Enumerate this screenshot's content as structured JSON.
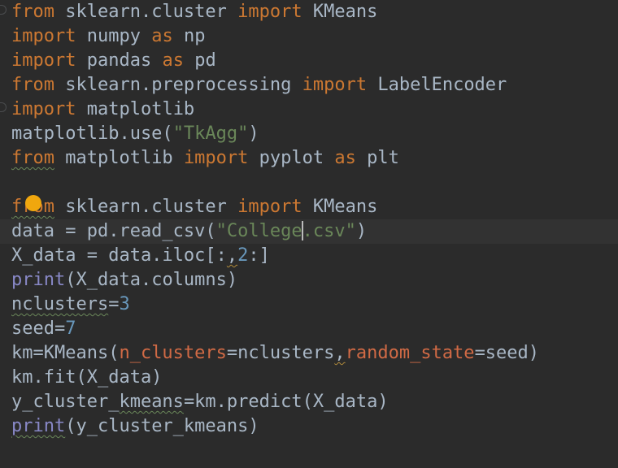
{
  "editor": {
    "lines": [
      {
        "t": [
          [
            "kw",
            "from"
          ],
          [
            "id",
            " sklearn.cluster "
          ],
          [
            "kw",
            "import"
          ],
          [
            "id",
            " KMeans"
          ]
        ]
      },
      {
        "t": [
          [
            "kw",
            "import"
          ],
          [
            "id",
            " numpy "
          ],
          [
            "kw",
            "as"
          ],
          [
            "id",
            " np"
          ]
        ]
      },
      {
        "t": [
          [
            "kw",
            "import"
          ],
          [
            "id",
            " pandas "
          ],
          [
            "kw",
            "as"
          ],
          [
            "id",
            " pd"
          ]
        ]
      },
      {
        "t": [
          [
            "kw",
            "from"
          ],
          [
            "id",
            " sklearn.preprocessing "
          ],
          [
            "kw",
            "import"
          ],
          [
            "id",
            " LabelEncoder"
          ]
        ]
      },
      {
        "t": [
          [
            "kw",
            "import"
          ],
          [
            "id",
            " matplotlib"
          ]
        ]
      },
      {
        "t": [
          [
            "id",
            "matplotlib.use("
          ],
          [
            "str",
            "\"TkAgg\""
          ],
          [
            "id",
            ")"
          ]
        ]
      },
      {
        "t": [
          [
            "kw squiggle",
            "from"
          ],
          [
            "id",
            " matplotlib "
          ],
          [
            "kw",
            "import"
          ],
          [
            "id",
            " pyplot "
          ],
          [
            "kw",
            "as"
          ],
          [
            "id",
            " plt"
          ]
        ]
      },
      {
        "t": []
      },
      {
        "t": [
          [
            "kw squiggle",
            "from"
          ],
          [
            "id",
            " sklearn.cluster "
          ],
          [
            "kw",
            "import"
          ],
          [
            "id",
            " KMeans"
          ]
        ]
      },
      {
        "t": [
          [
            "id",
            "data = pd.read_csv("
          ],
          [
            "str",
            "\"College"
          ],
          [
            "cursor",
            ""
          ],
          [
            "str",
            ".csv\""
          ],
          [
            "id",
            ")"
          ]
        ],
        "current": true
      },
      {
        "t": [
          [
            "id",
            "X_data = data.iloc[:"
          ],
          [
            "id squiggle-warn",
            ","
          ],
          [
            "num",
            "2"
          ],
          [
            "id",
            ":]"
          ]
        ]
      },
      {
        "t": [
          [
            "bi",
            "print"
          ],
          [
            "id",
            "(X_data.columns)"
          ]
        ]
      },
      {
        "t": [
          [
            "id squiggle",
            "nclusters"
          ],
          [
            "id",
            "="
          ],
          [
            "num",
            "3"
          ]
        ]
      },
      {
        "t": [
          [
            "id",
            "seed="
          ],
          [
            "num",
            "7"
          ]
        ]
      },
      {
        "t": [
          [
            "id",
            "km=KMeans("
          ],
          [
            "param",
            "n_clusters"
          ],
          [
            "id",
            "=nclusters"
          ],
          [
            "id squiggle-warn",
            ","
          ],
          [
            "param",
            "random_state"
          ],
          [
            "id",
            "=seed)"
          ]
        ]
      },
      {
        "t": [
          [
            "id",
            "km.fit(X_data)"
          ]
        ]
      },
      {
        "t": [
          [
            "id",
            "y_cluster_"
          ],
          [
            "id squiggle",
            "kmeans"
          ],
          [
            "id",
            "=km.predict(X_data)"
          ]
        ]
      },
      {
        "t": [
          [
            "bi squiggle",
            "print"
          ],
          [
            "id",
            "(y_cluster_kmeans)"
          ]
        ]
      }
    ]
  },
  "colors": {
    "background": "#2b2b2b",
    "keyword": "#cc7832",
    "identifier": "#a9b7c6",
    "string": "#6a8759",
    "number": "#6897bb",
    "builtin": "#8888c6",
    "param": "#d16a45",
    "lightbulb": "#f0a70e"
  },
  "icons": {
    "intention": "lightbulb-icon"
  }
}
